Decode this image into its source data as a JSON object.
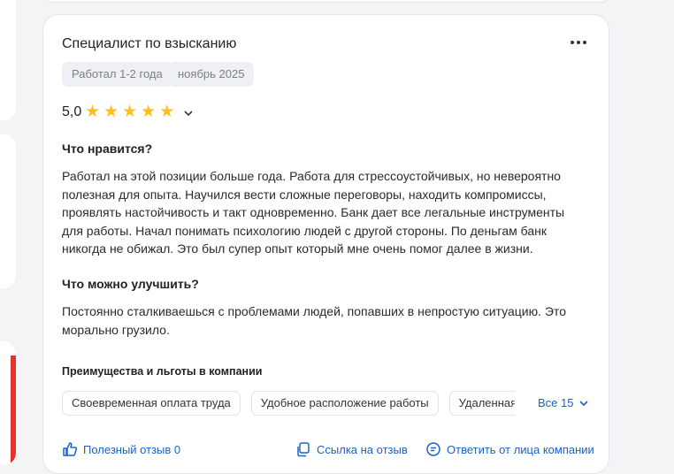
{
  "review": {
    "title": "Специалист по взысканию",
    "tags": [
      "Работал 1-2 года",
      "ноябрь 2025"
    ],
    "rating": "5,0",
    "stars": 5,
    "likes_heading": "Что нравится?",
    "likes_text": "Работал на этой позиции больше года. Работа для стрессоустойчивых, но невероятно полезная для опыта. Научился вести сложные переговоры, находить компромиссы, проявлять настойчивость и такт одновременно. Банк дает все легальные инструменты для работы. Начал понимать психологию людей с другой стороны. По деньгам банк никогда не обижал. Это был супер опыт который мне очень помог далее в жизни.",
    "improve_heading": "Что можно улучшить?",
    "improve_text": "Постоянно сталкиваешься с проблемами людей, попавших в непростую ситуацию. Это морально грузило.",
    "benefits_heading": "Преимущества и льготы в компании",
    "benefits": [
      "Своевременная оплата труда",
      "Удобное расположение работы",
      "Удаленная работа"
    ],
    "all_benefits_label": "Все 15",
    "actions": {
      "useful": "Полезный отзыв 0",
      "link": "Ссылка на отзыв",
      "reply": "Ответить от лица компании"
    }
  },
  "colors": {
    "accent": "#1a62c7",
    "star": "#ffbe1f",
    "brand_red": "#e8322b"
  }
}
